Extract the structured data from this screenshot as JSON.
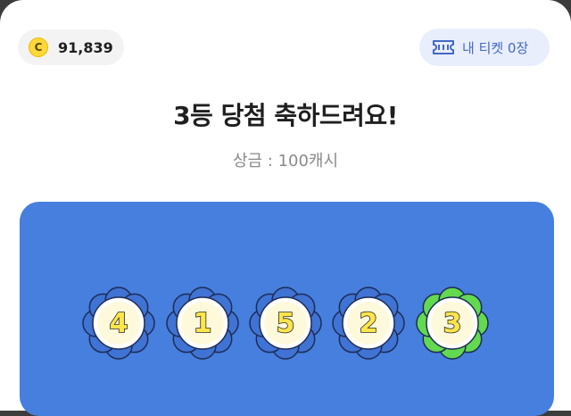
{
  "header": {
    "coin_icon_letter": "C",
    "coin_balance": "91,839",
    "ticket_label": "내 티켓 0장",
    "ticket_icon": "ticket-icon",
    "coin_icon": "coin-icon"
  },
  "result": {
    "title": "3등 당첨 축하드려요!",
    "prize": "상금 : 100캐시"
  },
  "winning_numbers": [
    {
      "number": "4",
      "matched": false
    },
    {
      "number": "1",
      "matched": false
    },
    {
      "number": "5",
      "matched": false
    },
    {
      "number": "2",
      "matched": false
    },
    {
      "number": "3",
      "matched": true
    }
  ],
  "colors": {
    "board": "#467fde",
    "flower_default": "#3f73d4",
    "flower_matched": "#62d94f",
    "ball_fill": "#fde54a",
    "accent": "#4468c7"
  }
}
